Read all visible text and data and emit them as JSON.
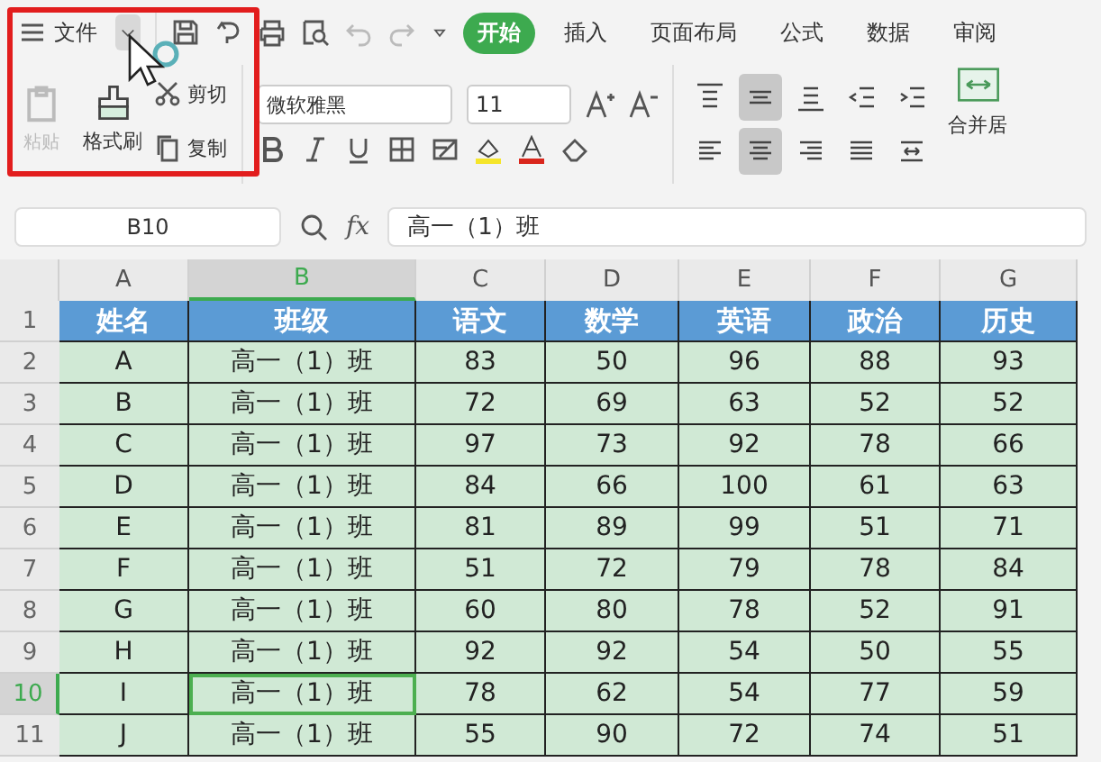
{
  "menu": {
    "label": "文件"
  },
  "tabs": [
    {
      "label": "开始",
      "selected": true
    },
    {
      "label": "插入",
      "selected": false
    },
    {
      "label": "页面布局",
      "selected": false
    },
    {
      "label": "公式",
      "selected": false
    },
    {
      "label": "数据",
      "selected": false
    },
    {
      "label": "审阅",
      "selected": false
    }
  ],
  "clipboard": {
    "paste": {
      "label": "粘贴",
      "disabled": true
    },
    "cut": "剪切",
    "copy": "复制",
    "format_painter": "格式刷"
  },
  "font": {
    "family": "微软雅黑",
    "size": "11"
  },
  "align_buttons": [
    {
      "kind": "top",
      "selected": false
    },
    {
      "kind": "middle",
      "selected": true
    },
    {
      "kind": "bottom",
      "selected": false
    },
    {
      "kind": "outdent",
      "selected": false
    },
    {
      "kind": "indent",
      "selected": false
    },
    {
      "kind": "left",
      "selected": false
    },
    {
      "kind": "center",
      "selected": true
    },
    {
      "kind": "right",
      "selected": false
    },
    {
      "kind": "justify",
      "selected": false
    },
    {
      "kind": "distribute",
      "selected": false
    }
  ],
  "merge": {
    "label": "合并居"
  },
  "name_box": {
    "value": "B10"
  },
  "formula": {
    "function_label": "fx",
    "value": "高一（1）班"
  },
  "columns": [
    {
      "label": "A",
      "selected": false
    },
    {
      "label": "B",
      "selected": true
    },
    {
      "label": "C",
      "selected": false
    },
    {
      "label": "D",
      "selected": false
    },
    {
      "label": "E",
      "selected": false
    },
    {
      "label": "F",
      "selected": false
    },
    {
      "label": "G",
      "selected": false
    }
  ],
  "rows": [
    {
      "number": "1",
      "kind": "header",
      "selected": false,
      "cells": [
        "姓名",
        "班级",
        "语文",
        "数学",
        "英语",
        "政治",
        "历史"
      ]
    },
    {
      "number": "2",
      "kind": "data",
      "selected": false,
      "cells": [
        "A",
        "高一（1）班",
        "83",
        "50",
        "96",
        "88",
        "93"
      ]
    },
    {
      "number": "3",
      "kind": "data",
      "selected": false,
      "cells": [
        "B",
        "高一（1）班",
        "72",
        "69",
        "63",
        "52",
        "52"
      ]
    },
    {
      "number": "4",
      "kind": "data",
      "selected": false,
      "cells": [
        "C",
        "高一（1）班",
        "97",
        "73",
        "92",
        "78",
        "66"
      ]
    },
    {
      "number": "5",
      "kind": "data",
      "selected": false,
      "cells": [
        "D",
        "高一（1）班",
        "84",
        "66",
        "100",
        "61",
        "63"
      ]
    },
    {
      "number": "6",
      "kind": "data",
      "selected": false,
      "cells": [
        "E",
        "高一（1）班",
        "81",
        "89",
        "99",
        "51",
        "71"
      ]
    },
    {
      "number": "7",
      "kind": "data",
      "selected": false,
      "cells": [
        "F",
        "高一（1）班",
        "51",
        "72",
        "79",
        "78",
        "84"
      ]
    },
    {
      "number": "8",
      "kind": "data",
      "selected": false,
      "cells": [
        "G",
        "高一（1）班",
        "60",
        "80",
        "78",
        "52",
        "91"
      ]
    },
    {
      "number": "9",
      "kind": "data",
      "selected": false,
      "cells": [
        "H",
        "高一（1）班",
        "92",
        "92",
        "54",
        "50",
        "55"
      ]
    },
    {
      "number": "10",
      "kind": "data",
      "selected": true,
      "cells": [
        "I",
        "高一（1）班",
        "78",
        "62",
        "54",
        "77",
        "59"
      ]
    },
    {
      "number": "11",
      "kind": "data",
      "selected": false,
      "cells": [
        "J",
        "高一（1）班",
        "55",
        "90",
        "72",
        "74",
        "51"
      ]
    }
  ]
}
